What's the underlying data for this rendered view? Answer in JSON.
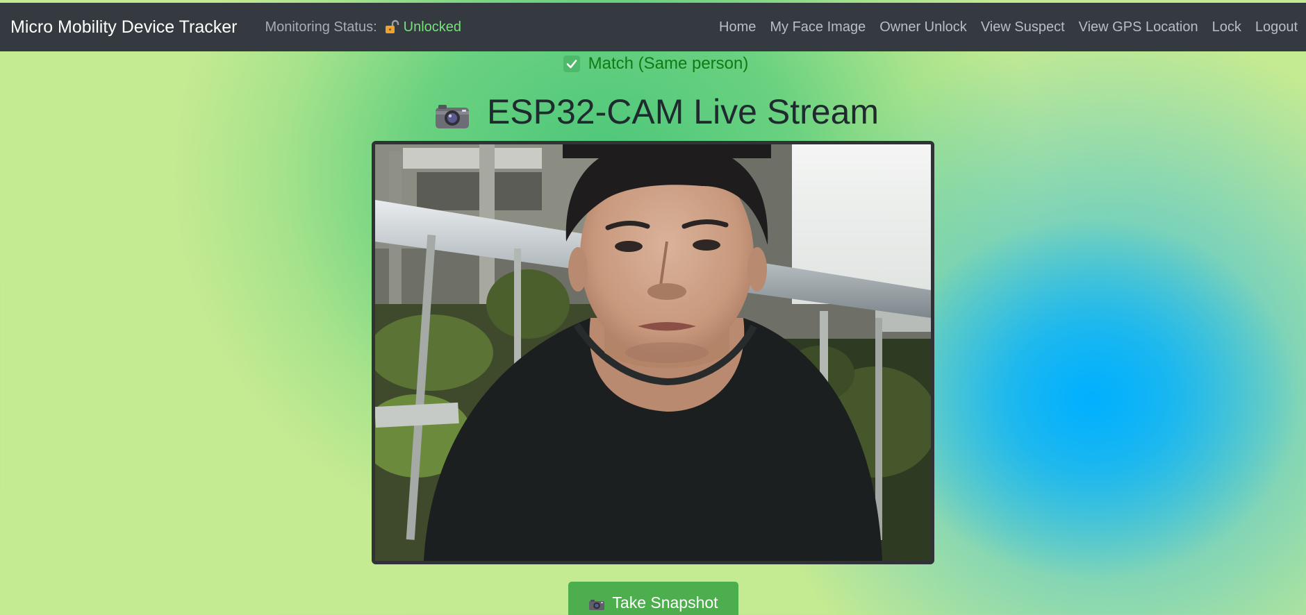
{
  "navbar": {
    "brand": "Micro Mobility Device Tracker",
    "status_label": "Monitoring Status:",
    "status_icon": "unlocked-padlock-icon",
    "status_value": "Unlocked",
    "status_color": "#79e07c",
    "links": [
      "Home",
      "My Face Image",
      "Owner Unlock",
      "View Suspect",
      "View GPS Location",
      "Lock",
      "Logout"
    ]
  },
  "match": {
    "icon": "checkmark-icon",
    "text": "Match (Same person)",
    "color": "#127a14"
  },
  "stream": {
    "icon": "camera-icon",
    "title": "ESP32-CAM Live Stream"
  },
  "snapshot": {
    "icon": "camera-icon",
    "label": "Take Snapshot",
    "color": "#4cae4c"
  }
}
